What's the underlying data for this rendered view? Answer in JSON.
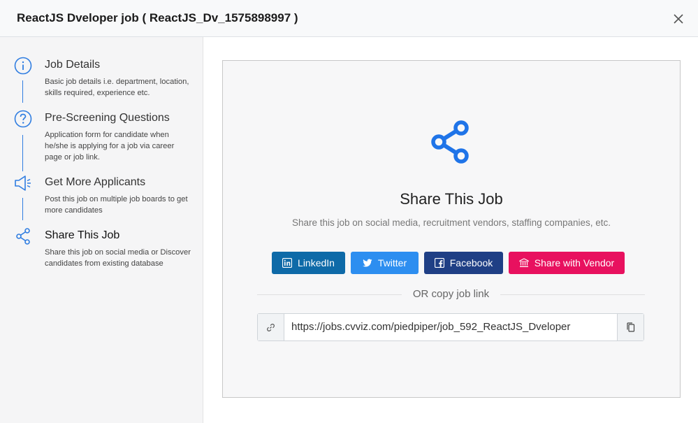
{
  "header": {
    "title": "ReactJS Dveloper job ( ReactJS_Dv_1575898997 )"
  },
  "steps": [
    {
      "title": "Job Details",
      "desc": "Basic job details i.e. department, location, skills required, experience etc."
    },
    {
      "title": "Pre-Screening Questions",
      "desc": "Application form for candidate when he/she is applying for a job via career page or job link."
    },
    {
      "title": "Get More Applicants",
      "desc": "Post this job on multiple job boards to get more candidates"
    },
    {
      "title": "Share This Job",
      "desc": "Share this job on social media or Discover candidates from existing database"
    }
  ],
  "share": {
    "heading": "Share This Job",
    "subtitle": "Share this job on social media, recruitment vendors, staffing companies, etc.",
    "buttons": [
      {
        "label": "LinkedIn",
        "color": "#0e6aa8"
      },
      {
        "label": "Twitter",
        "color": "#2d8ef0"
      },
      {
        "label": "Facebook",
        "color": "#1f3f85"
      },
      {
        "label": "Share with Vendor",
        "color": "#e8115f"
      }
    ],
    "or_text": "OR copy job link",
    "job_link": "https://jobs.cvviz.com/piedpiper/job_592_ReactJS_Dveloper"
  },
  "colors": {
    "accent": "#2f7de1"
  }
}
